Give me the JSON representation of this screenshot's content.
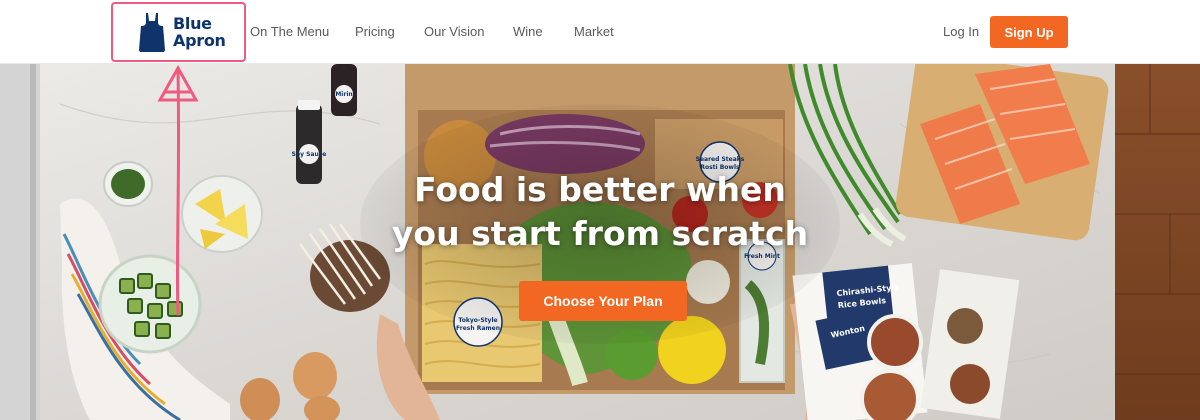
{
  "brand": {
    "line1": "Blue",
    "line2": "Apron",
    "color": "#0f346c"
  },
  "nav": {
    "items": [
      {
        "label": "On The Menu"
      },
      {
        "label": "Pricing"
      },
      {
        "label": "Our Vision"
      },
      {
        "label": "Wine"
      },
      {
        "label": "Market"
      }
    ],
    "login_label": "Log In",
    "signup_label": "Sign Up"
  },
  "hero": {
    "headline_line1": "Food is better when",
    "headline_line2": "you start from scratch",
    "cta_label": "Choose Your Plan"
  },
  "product_labels": {
    "bottle_small": "Mirin",
    "bottle_soy": "Soy Sauce",
    "seared_steaks": "Seared Steaks Rosti Bowls",
    "fresh_ramen": "Tokyo-Style Fresh Ramen",
    "fresh_mint": "Fresh Mint",
    "card_rice_bowls": "Chirashi-Style Rice Bowls",
    "card_wonton": "Wonton"
  },
  "colors": {
    "accent": "#f26722",
    "highlight_outline": "#f05a7e",
    "nav_text": "#5a5a5a"
  }
}
